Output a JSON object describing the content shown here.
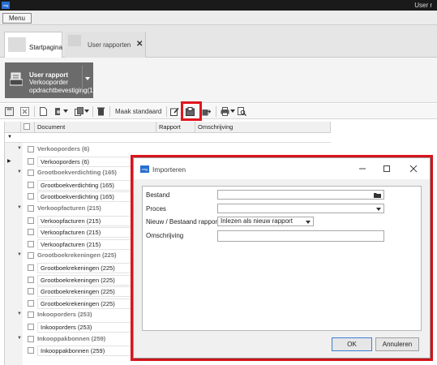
{
  "app": {
    "logo_text": "mtg",
    "user_label": "User r"
  },
  "menu": {
    "label": "Menu"
  },
  "tabs": [
    {
      "label": "Startpagina"
    },
    {
      "label": "User rapporten",
      "close": "✕"
    }
  ],
  "ribbon": {
    "title": "User rapport",
    "subtitle": "Verkooporder opdrachtbevestiging(1)"
  },
  "toolbar": {
    "maak_standaard": "Maak standaard",
    "icons": [
      "save-icon",
      "cancel-icon",
      "new-icon",
      "open-icon",
      "copy-icon",
      "delete-icon",
      "edit-icon",
      "import-icon",
      "export-icon",
      "print-icon",
      "preview-icon"
    ]
  },
  "grid": {
    "columns": [
      "Document",
      "Rapport",
      "Omschrijving"
    ],
    "filter_marker": "▼",
    "rows": [
      {
        "type": "group",
        "label": "Verkooporders (6)"
      },
      {
        "type": "item",
        "label": "Verkooporders (6)",
        "current": true
      },
      {
        "type": "group",
        "label": "Grootboekverdichting (165)"
      },
      {
        "type": "item",
        "label": "Grootboekverdichting (165)"
      },
      {
        "type": "item",
        "label": "Grootboekverdichting (165)"
      },
      {
        "type": "group",
        "label": "Verkoopfacturen (215)"
      },
      {
        "type": "item",
        "label": "Verkoopfacturen (215)"
      },
      {
        "type": "item",
        "label": "Verkoopfacturen (215)"
      },
      {
        "type": "item",
        "label": "Verkoopfacturen (215)"
      },
      {
        "type": "group",
        "label": "Grootboekrekeningen (225)"
      },
      {
        "type": "item",
        "label": "Grootboekrekeningen (225)"
      },
      {
        "type": "item",
        "label": "Grootboekrekeningen (225)"
      },
      {
        "type": "item",
        "label": "Grootboekrekeningen (225)"
      },
      {
        "type": "item",
        "label": "Grootboekrekeningen (225)"
      },
      {
        "type": "group",
        "label": "Inkooporders (253)"
      },
      {
        "type": "item",
        "label": "Inkooporders (253)"
      },
      {
        "type": "group",
        "label": "Inkooppakbonnen (259)"
      },
      {
        "type": "item",
        "label": "Inkooppakbonnen (259)"
      }
    ]
  },
  "dialog": {
    "logo_text": "mtg",
    "title": "Importeren",
    "fields": {
      "bestand": {
        "label": "Bestand",
        "value": ""
      },
      "proces": {
        "label": "Proces",
        "value": ""
      },
      "nieuw": {
        "label": "Nieuw / Bestaand rapport",
        "value": "Inlezen als nieuw rapport"
      },
      "omschrijving": {
        "label": "Omschrijving",
        "value": ""
      }
    },
    "ok": "OK",
    "annuleren": "Annuleren"
  },
  "colors": {
    "highlight": "#e0151c",
    "accent": "#2a6fd1"
  }
}
